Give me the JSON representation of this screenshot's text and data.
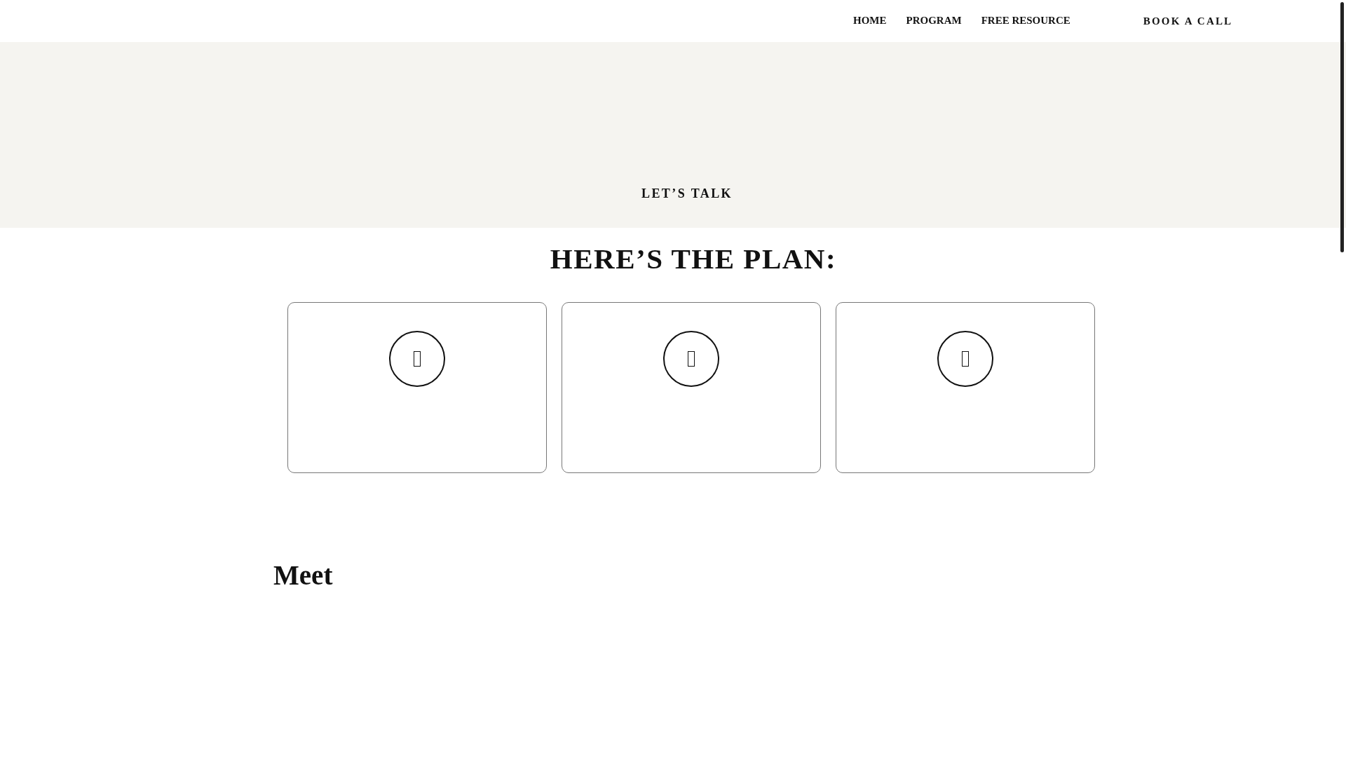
{
  "header": {
    "nav": [
      {
        "label": "HOME"
      },
      {
        "label": "PROGRAM"
      },
      {
        "label": "FREE RESOURCE"
      }
    ],
    "cta": "BOOK A CALL"
  },
  "hero": {
    "label": "LET’S TALK"
  },
  "plan": {
    "heading": "HERE’S THE PLAN:",
    "cards": [
      {
        "kind": "icon"
      },
      {
        "kind": "icon"
      },
      {
        "kind": "icon"
      }
    ]
  },
  "meet": {
    "heading": "Meet"
  }
}
